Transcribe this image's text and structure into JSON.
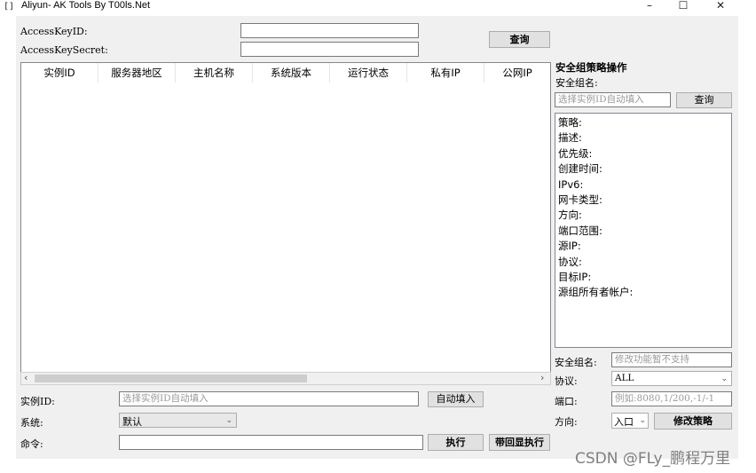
{
  "window": {
    "title": "Aliyun- AK Tools By T00ls.Net",
    "icon_glyph": "[]",
    "minimize": "–",
    "maximize": "☐",
    "close": "✕"
  },
  "credentials": {
    "access_key_id_label": "AccessKeyID:",
    "access_key_secret_label": "AccessKeySecret:",
    "query_button": "查询"
  },
  "instances": {
    "columns": [
      "实例ID",
      "服务器地区",
      "主机名称",
      "系统版本",
      "运行状态",
      "私有IP",
      "公网IP"
    ],
    "rows": []
  },
  "command": {
    "instance_id_label": "实例ID:",
    "instance_id_placeholder": "选择实例ID自动填入",
    "autofill_button": "自动填入",
    "system_label": "系统:",
    "system_value": "默认",
    "command_label": "命令:",
    "execute_button": "执行",
    "execute_echo_button": "带回显执行"
  },
  "security_group": {
    "heading": "安全组策略操作",
    "name_label": "安全组名:",
    "instance_placeholder": "选择实例ID自动填入",
    "query_button": "查询",
    "details": [
      "策略:",
      "描述:",
      "优先级:",
      "创建时间:",
      "IPv6:",
      "网卡类型:",
      "方向:",
      "端口范围:",
      "源IP:",
      "协议:",
      "目标IP:",
      "源组所有者帐户:"
    ],
    "modify_name_label": "安全组名:",
    "modify_name_placeholder": "修改功能暂不支持",
    "protocol_label": "协议:",
    "protocol_value": "ALL",
    "port_label": "端口:",
    "port_placeholder": "例如:8080,1/200,-1/-1",
    "direction_label": "方向:",
    "direction_value": "入口",
    "modify_button": "修改策略"
  },
  "watermark": "CSDN @FLy_鹏程万里"
}
